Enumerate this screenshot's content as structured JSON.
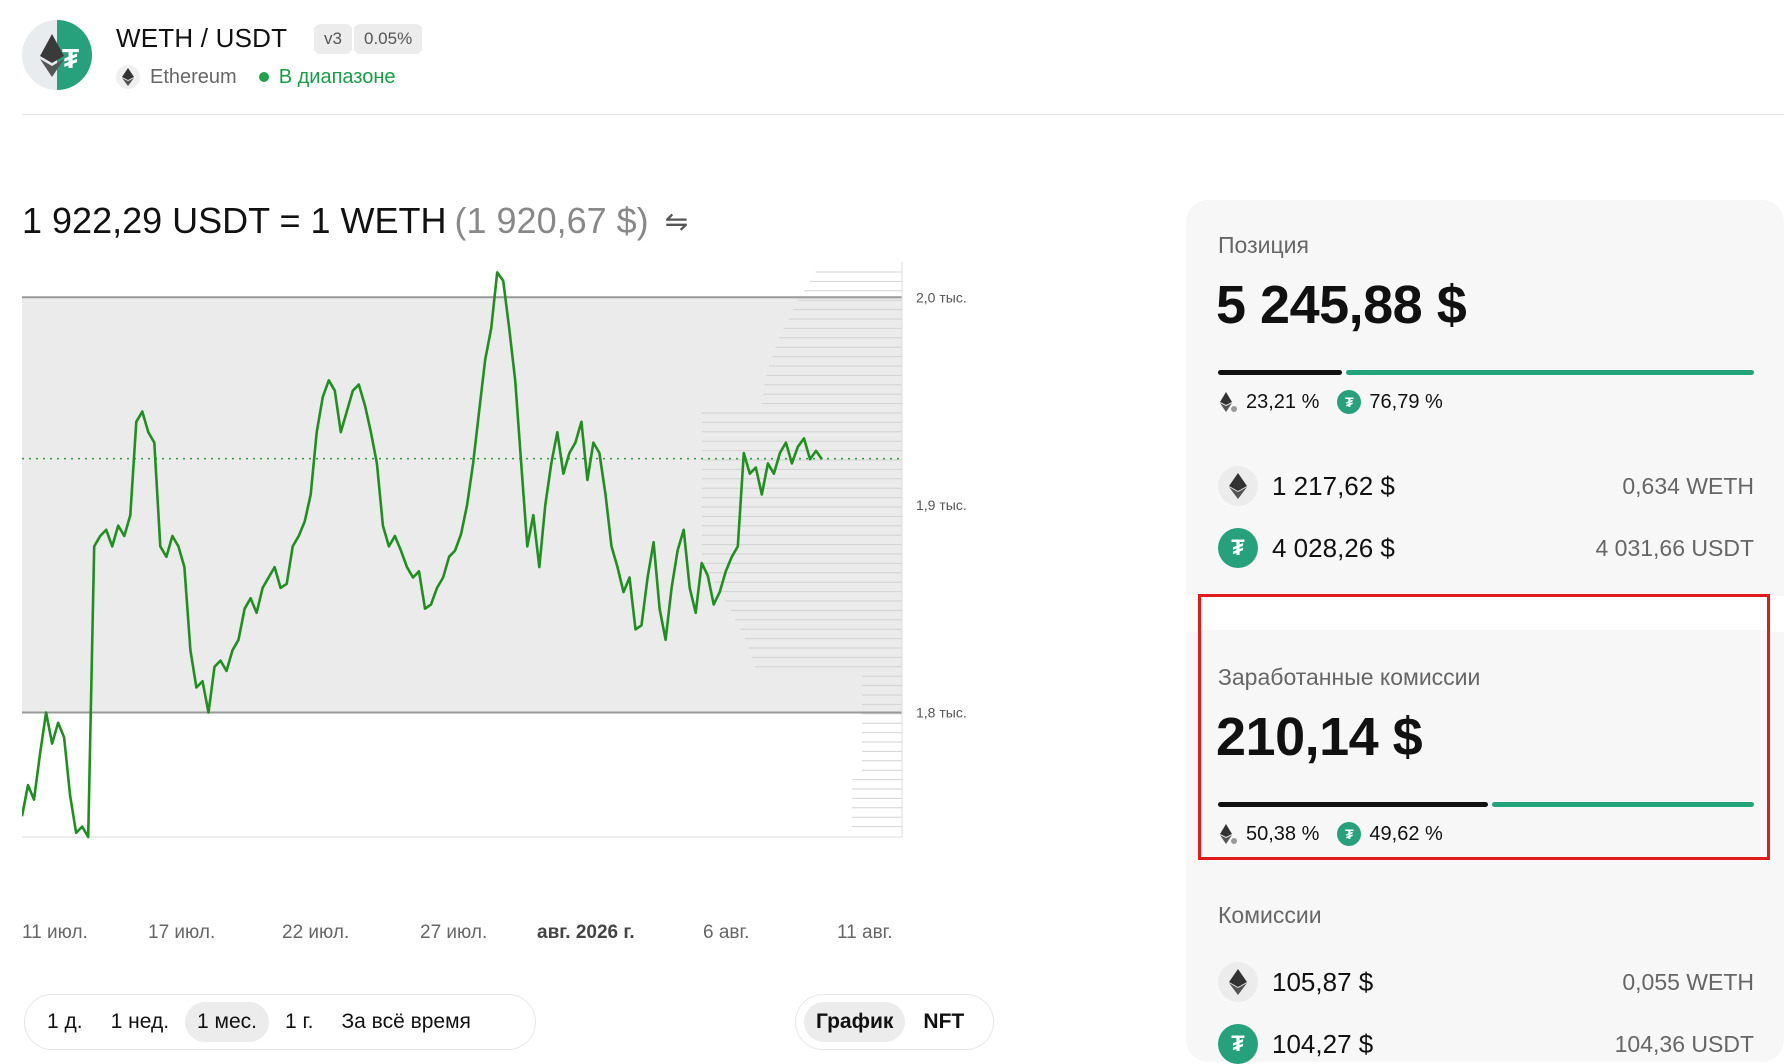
{
  "header": {
    "pair": "WETH / USDT",
    "version_badge": "v3",
    "fee_badge": "0.05%",
    "network": "Ethereum",
    "status": "В диапазоне"
  },
  "price": {
    "text": "1 922,29 USDT = 1 WETH",
    "usd_text": "(1 920,67 $)",
    "swap_icon": "⇋"
  },
  "chart_data": {
    "type": "line",
    "x_labels": [
      "11 июл.",
      "17 июл.",
      "22 июл.",
      "27 июл.",
      "авг. 2026 г.",
      "6 авг.",
      "11 авг."
    ],
    "y_ticks": [
      "2,0 тыс.",
      "1,9 тыс.",
      "1,8 тыс."
    ],
    "ylim": [
      1740,
      2017
    ],
    "range": {
      "min": 1800,
      "max": 2000
    },
    "current_price": 1922.29,
    "series": [
      {
        "color": "#1f8f1f",
        "values": [
          1750,
          1765,
          1758,
          1780,
          1800,
          1785,
          1795,
          1788,
          1760,
          1742,
          1745,
          1740,
          1880,
          1885,
          1888,
          1880,
          1890,
          1885,
          1895,
          1940,
          1945,
          1935,
          1930,
          1880,
          1875,
          1885,
          1880,
          1870,
          1830,
          1812,
          1815,
          1800,
          1822,
          1825,
          1820,
          1830,
          1835,
          1850,
          1855,
          1848,
          1860,
          1865,
          1870,
          1860,
          1862,
          1880,
          1885,
          1892,
          1905,
          1935,
          1952,
          1960,
          1955,
          1935,
          1945,
          1955,
          1958,
          1948,
          1935,
          1920,
          1890,
          1880,
          1885,
          1878,
          1870,
          1865,
          1868,
          1850,
          1852,
          1860,
          1865,
          1875,
          1878,
          1886,
          1900,
          1920,
          1945,
          1970,
          1985,
          2012,
          2008,
          1985,
          1960,
          1920,
          1880,
          1895,
          1870,
          1900,
          1920,
          1935,
          1915,
          1925,
          1930,
          1940,
          1912,
          1930,
          1925,
          1905,
          1880,
          1870,
          1858,
          1865,
          1840,
          1842,
          1865,
          1882,
          1850,
          1835,
          1860,
          1878,
          1888,
          1860,
          1848,
          1872,
          1866,
          1852,
          1858,
          1868,
          1875,
          1880,
          1925,
          1915,
          1918,
          1905,
          1920,
          1915,
          1925,
          1930,
          1920,
          1928,
          1932,
          1922,
          1926,
          1922
        ]
      }
    ]
  },
  "controls": {
    "ranges": [
      "1 д.",
      "1 нед.",
      "1 мес.",
      "1 г.",
      "За всё время"
    ],
    "active_range": "1 мес.",
    "views": [
      "График",
      "NFT"
    ],
    "active_view": "График"
  },
  "position": {
    "title": "Позиция",
    "value": "5 245,88 $",
    "eth_pct": "23,21 %",
    "usdt_pct": "76,79 %",
    "eth_share": 0.2321,
    "eth_usd": "1 217,62 $",
    "eth_amount": "0,634 WETH",
    "usdt_usd": "4 028,26 $",
    "usdt_amount": "4 031,66 USDT"
  },
  "earned": {
    "title": "Заработанные комиссии",
    "value": "210,14 $",
    "eth_pct": "50,38 %",
    "usdt_pct": "49,62 %",
    "eth_share": 0.5038
  },
  "fees": {
    "title": "Комиссии",
    "eth_usd": "105,87 $",
    "eth_amount": "0,055 WETH",
    "usdt_usd": "104,27 $",
    "usdt_amount": "104,36 USDT"
  },
  "colors": {
    "accent_green": "#23a37a",
    "line_green": "#1f8f1f",
    "in_range_green": "#1a9d48",
    "highlight_red": "#e01b1b"
  }
}
